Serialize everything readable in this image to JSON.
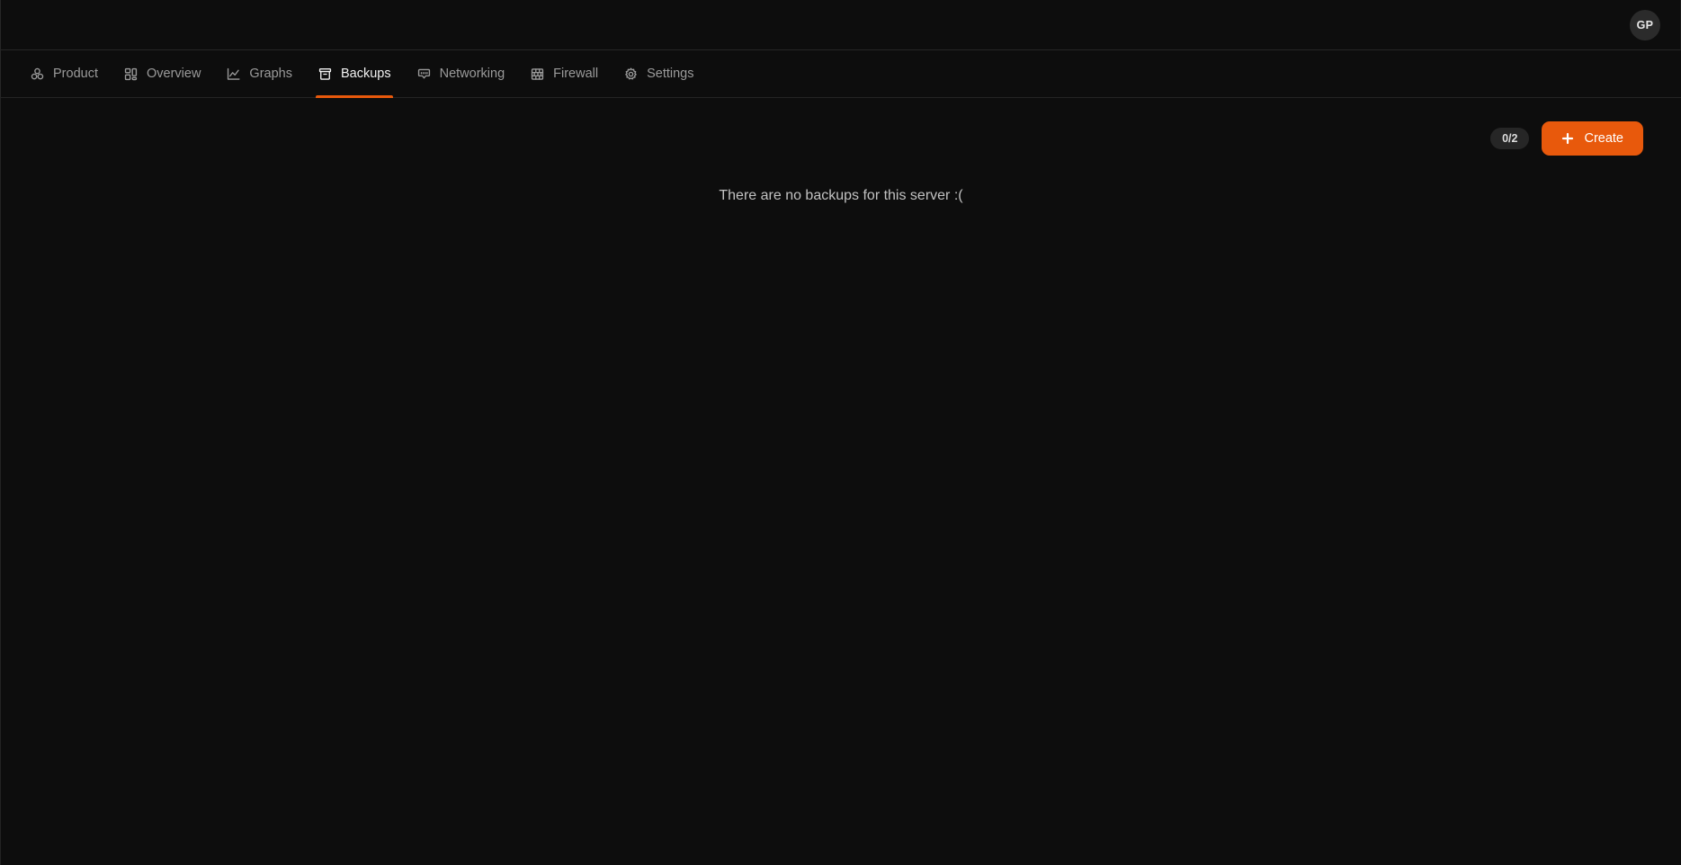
{
  "topbar": {
    "avatar_initials": "GP",
    "avatar_icon": "user-avatar"
  },
  "nav": {
    "active_tab": "Backups",
    "accent_color": "#e8590c",
    "tabs": [
      {
        "label": "Product",
        "icon": "product-cluster-icon",
        "active": false
      },
      {
        "label": "Overview",
        "icon": "layout-grid-icon",
        "active": false
      },
      {
        "label": "Graphs",
        "icon": "line-chart-icon",
        "active": false
      },
      {
        "label": "Backups",
        "icon": "archive-box-icon",
        "active": true
      },
      {
        "label": "Networking",
        "icon": "ethernet-port-icon",
        "active": false
      },
      {
        "label": "Firewall",
        "icon": "brick-wall-icon",
        "active": false
      },
      {
        "label": "Settings",
        "icon": "gear-icon",
        "active": false
      }
    ]
  },
  "main": {
    "backup_count_badge": "0/2",
    "create_button_label": "Create",
    "create_button_icon": "plus-icon",
    "empty_state_message": "There are no backups for this server :("
  },
  "theme": {
    "background": "#0d0d0d",
    "accent": "#e8590c",
    "border": "#242424",
    "muted_text": "#9b9b9b",
    "active_text": "#f2f2f2",
    "badge_background": "#262626"
  }
}
